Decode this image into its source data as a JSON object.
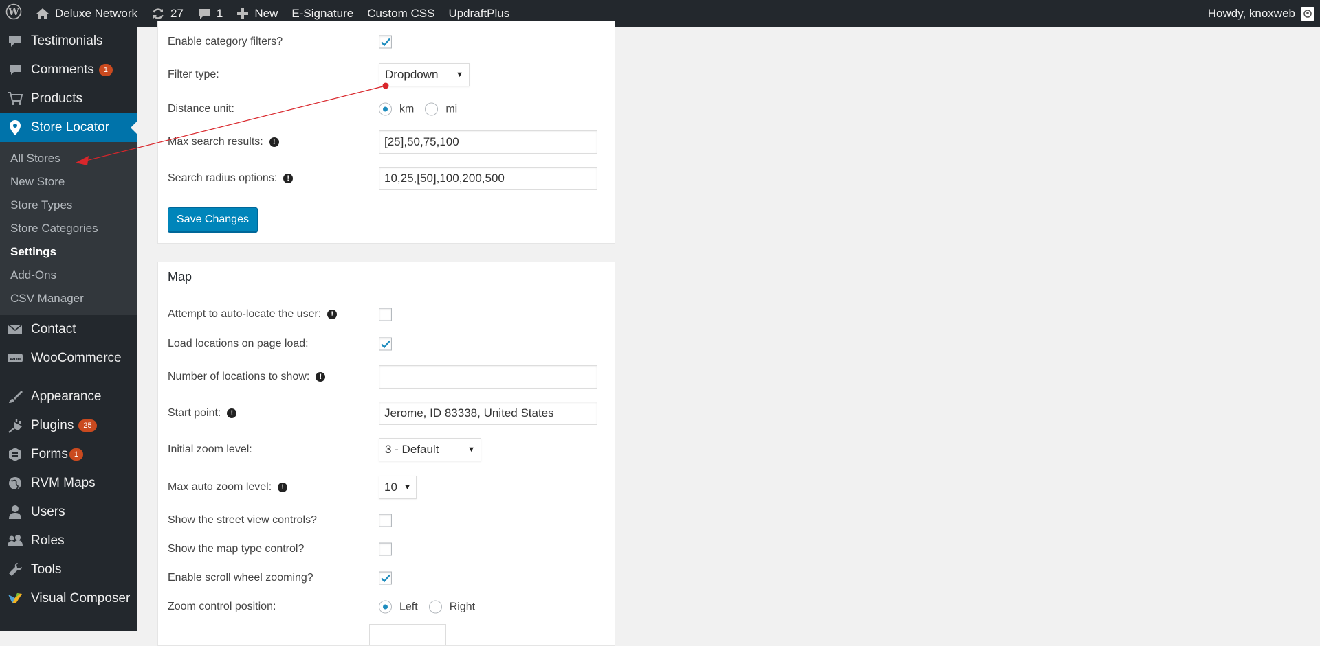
{
  "adminbar": {
    "site_name": "Deluxe Network",
    "updates_count": "27",
    "comments_count": "1",
    "new_label": "New",
    "links": [
      "E-Signature",
      "Custom CSS",
      "UpdraftPlus"
    ],
    "greeting": "Howdy, knoxweb"
  },
  "sidebar": {
    "items_top": [
      {
        "label": "Testimonials",
        "icon": "speech-bubble-icon"
      },
      {
        "label": "Comments",
        "icon": "comment-icon",
        "badge": "1"
      },
      {
        "label": "Products",
        "icon": "cart-icon"
      }
    ],
    "current": {
      "label": "Store Locator",
      "icon": "map-pin-icon"
    },
    "submenu": [
      "All Stores",
      "New Store",
      "Store Types",
      "Store Categories",
      "Settings",
      "Add-Ons",
      "CSV Manager"
    ],
    "submenu_active": "Settings",
    "items_mid": [
      {
        "label": "Contact",
        "icon": "envelope-icon"
      },
      {
        "label": "WooCommerce",
        "icon": "woo-icon"
      }
    ],
    "items_bottom": [
      {
        "label": "Appearance",
        "icon": "brush-icon"
      },
      {
        "label": "Plugins",
        "icon": "plug-icon",
        "badge": "25"
      },
      {
        "label": "Forms",
        "icon": "forms-icon",
        "badge": "1"
      },
      {
        "label": "RVM Maps",
        "icon": "globe-icon"
      },
      {
        "label": "Users",
        "icon": "user-icon"
      },
      {
        "label": "Roles",
        "icon": "group-icon"
      },
      {
        "label": "Tools",
        "icon": "wrench-icon"
      },
      {
        "label": "Visual Composer",
        "icon": "vc-icon"
      }
    ]
  },
  "search_panel": {
    "enable_category_filters": {
      "label": "Enable category filters?",
      "checked": true
    },
    "filter_type": {
      "label": "Filter type:",
      "value": "Dropdown"
    },
    "distance_unit": {
      "label": "Distance unit:",
      "options": [
        "km",
        "mi"
      ],
      "selected": "km"
    },
    "max_search_results": {
      "label": "Max search results:",
      "value": "[25],50,75,100"
    },
    "search_radius_options": {
      "label": "Search radius options:",
      "value": "10,25,[50],100,200,500"
    },
    "save_label": "Save Changes"
  },
  "map_panel": {
    "title": "Map",
    "auto_locate": {
      "label": "Attempt to auto-locate the user:",
      "checked": false
    },
    "load_on_page_load": {
      "label": "Load locations on page load:",
      "checked": true
    },
    "num_locations": {
      "label": "Number of locations to show:",
      "value": ""
    },
    "start_point": {
      "label": "Start point:",
      "value": "Jerome, ID 83338, United States"
    },
    "initial_zoom": {
      "label": "Initial zoom level:",
      "value": "3 - Default"
    },
    "max_auto_zoom": {
      "label": "Max auto zoom level:",
      "value": "10"
    },
    "street_view": {
      "label": "Show the street view controls?",
      "checked": false
    },
    "map_type_control": {
      "label": "Show the map type control?",
      "checked": false
    },
    "scroll_zoom": {
      "label": "Enable scroll wheel zooming?",
      "checked": true
    },
    "zoom_position": {
      "label": "Zoom control position:",
      "options": [
        "Left",
        "Right"
      ],
      "selected": "Left"
    }
  },
  "colors": {
    "adminbar_bg": "#23282d",
    "accent": "#0073aa",
    "button": "#0085ba",
    "badge": "#ca4a1f",
    "annotation_arrow": "#d9262b"
  }
}
